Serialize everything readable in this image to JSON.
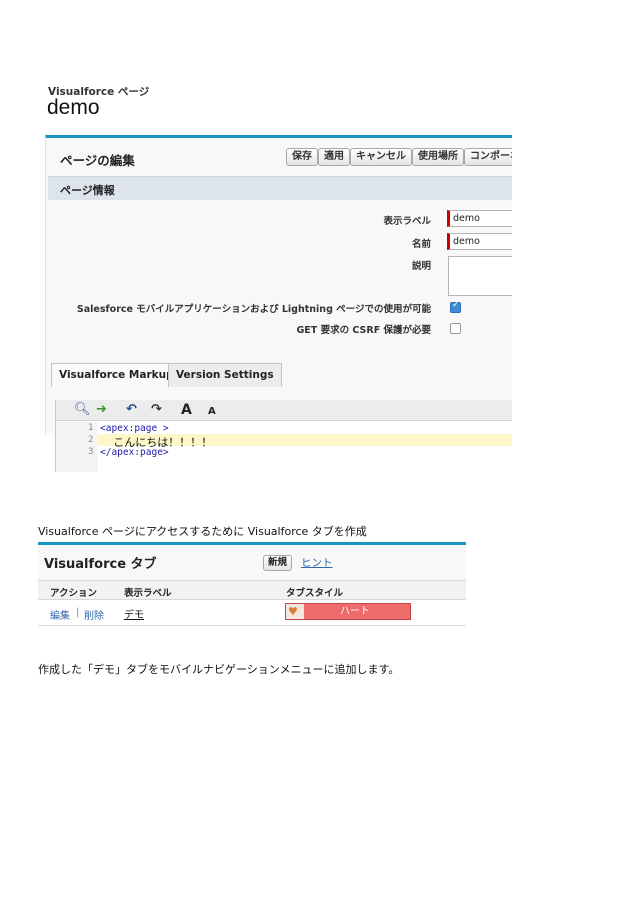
{
  "page_editor": {
    "subtitle": "Visualforce ページ",
    "title": "demo",
    "section_heading": "ページの編集",
    "buttons": [
      "保存",
      "適用",
      "キャンセル",
      "使用場所",
      "コンポーネ"
    ],
    "info_section_title": "ページ情報",
    "fields": {
      "label_label": "表示ラベル",
      "label_value": "demo",
      "name_label": "名前",
      "name_value": "demo",
      "description_label": "説明",
      "mobile_label": "Salesforce モバイルアプリケーションおよび Lightning ページでの使用が可能",
      "mobile_checked": true,
      "csrf_label": "GET 要求の CSRF 保護が必要",
      "csrf_checked": false
    },
    "tabs": [
      "Visualforce Markup",
      "Version Settings"
    ],
    "toolbar": {
      "icons": [
        "search-icon",
        "go-arrow-icon",
        "undo-icon",
        "redo-icon",
        "font-increase-icon",
        "font-decrease-icon"
      ],
      "font_large": "A",
      "font_small": "A"
    },
    "code": {
      "line_numbers": [
        "1",
        "2",
        "3"
      ],
      "line1": "<apex:page >",
      "line2": "  こんにちは！！！！",
      "line3": "</apex:page>"
    }
  },
  "caption1": "Visualforce ページにアクセスするために Visualforce タブを作成",
  "tabs_list": {
    "title": "Visualforce タブ",
    "new_button": "新規",
    "hint_link": "ヒント",
    "columns": [
      "アクション",
      "表示ラベル",
      "タブスタイル"
    ],
    "row": {
      "edit": "編集",
      "separator": "|",
      "delete": "削除",
      "label": "デモ",
      "tab_style": "ハート",
      "tab_style_color": "#ef6b6b"
    }
  },
  "caption2": "作成した「デモ」タブをモバイルナビゲーションメニューに追加します。"
}
